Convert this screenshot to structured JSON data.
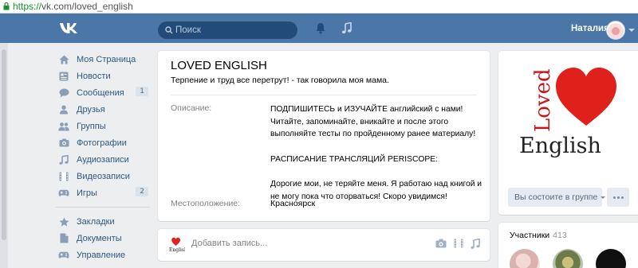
{
  "browser": {
    "url_scheme": "https://",
    "url_rest": "vk.com/loved_english"
  },
  "header": {
    "search_placeholder": "Поиск",
    "user_name": "Наталия",
    "brand_color": "#4a76a8"
  },
  "menu": {
    "items": [
      {
        "label": "Моя Страница",
        "icon": "home-icon",
        "count": ""
      },
      {
        "label": "Новости",
        "icon": "news-icon",
        "count": ""
      },
      {
        "label": "Сообщения",
        "icon": "messages-icon",
        "count": "1"
      },
      {
        "label": "Друзья",
        "icon": "friend-icon",
        "count": ""
      },
      {
        "label": "Группы",
        "icon": "groups-icon",
        "count": ""
      },
      {
        "label": "Фотографии",
        "icon": "camera-icon",
        "count": ""
      },
      {
        "label": "Аудиозаписи",
        "icon": "music-icon",
        "count": ""
      },
      {
        "label": "Видеозаписи",
        "icon": "video-icon",
        "count": ""
      },
      {
        "label": "Игры",
        "icon": "gamepad-icon",
        "count": "2"
      }
    ],
    "items2": [
      {
        "label": "Закладки",
        "icon": "star-icon"
      },
      {
        "label": "Документы",
        "icon": "document-icon"
      },
      {
        "label": "Управление",
        "icon": "gamepad-icon"
      }
    ]
  },
  "group": {
    "title": "LOVED ENGLISH",
    "status": "Терпение и труд все перетрут! - так говорила моя мама.",
    "description_label": "Описание:",
    "description_lines": [
      "ПОДПИШИТЕСЬ и ИЗУЧАЙТЕ английский с нами!",
      "Читайте, запоминайте, вникайте и после этого",
      "выполняйте тесты по пройденному ранее материалу!",
      "",
      "РАСПИСАНИЕ ТРАНСЛЯЦИЙ PERISCOPE:",
      "",
      "Дорогие мои, не теряйте меня. Я работаю над книгой и",
      "не могу пока что оторваться! Скоро увидимся!"
    ],
    "location_label": "Местоположение:",
    "location_value": "Красноярск"
  },
  "composer": {
    "placeholder": "Добавить запись..."
  },
  "logo": {
    "word1": "Loved",
    "word2": "English",
    "heart_color": "#e0201b"
  },
  "side": {
    "join_label": "Вы состоите в группе",
    "members_label": "Участники",
    "members_count": "413"
  }
}
